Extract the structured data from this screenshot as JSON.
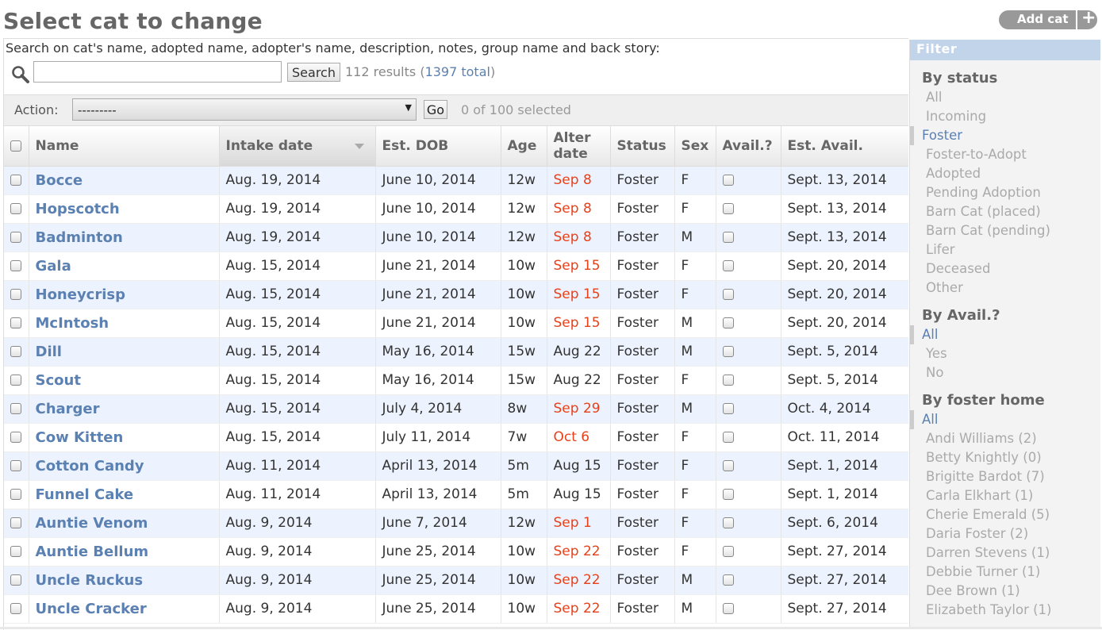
{
  "header": {
    "title": "Select cat to change",
    "add_label": "Add cat",
    "add_icon": "+"
  },
  "search": {
    "label": "Search on cat's name, adopted name, adopter's name, description, notes, group name and back story:",
    "value": "",
    "placeholder": "",
    "button_label": "Search",
    "results_prefix": "112 results (",
    "results_link": "1397 total",
    "results_suffix": ")"
  },
  "actions": {
    "label": "Action:",
    "selected_option": "---------",
    "go_label": "Go",
    "selected_count": "0 of 100 selected"
  },
  "table": {
    "columns": {
      "name": "Name",
      "intake": "Intake date",
      "dob": "Est. DOB",
      "age": "Age",
      "alter_line1": "Alter",
      "alter_line2": "date",
      "status": "Status",
      "sex": "Sex",
      "avail": "Avail.?",
      "est_avail": "Est. Avail."
    },
    "rows": [
      {
        "name": "Bocce",
        "intake": "Aug. 19, 2014",
        "dob": "June 10, 2014",
        "age": "12w",
        "alter": "Sep 8",
        "alter_overdue": true,
        "status": "Foster",
        "sex": "F",
        "est_avail": "Sept. 13, 2014"
      },
      {
        "name": "Hopscotch",
        "intake": "Aug. 19, 2014",
        "dob": "June 10, 2014",
        "age": "12w",
        "alter": "Sep 8",
        "alter_overdue": true,
        "status": "Foster",
        "sex": "F",
        "est_avail": "Sept. 13, 2014"
      },
      {
        "name": "Badminton",
        "intake": "Aug. 19, 2014",
        "dob": "June 10, 2014",
        "age": "12w",
        "alter": "Sep 8",
        "alter_overdue": true,
        "status": "Foster",
        "sex": "M",
        "est_avail": "Sept. 13, 2014"
      },
      {
        "name": "Gala",
        "intake": "Aug. 15, 2014",
        "dob": "June 21, 2014",
        "age": "10w",
        "alter": "Sep 15",
        "alter_overdue": true,
        "status": "Foster",
        "sex": "F",
        "est_avail": "Sept. 20, 2014"
      },
      {
        "name": "Honeycrisp",
        "intake": "Aug. 15, 2014",
        "dob": "June 21, 2014",
        "age": "10w",
        "alter": "Sep 15",
        "alter_overdue": true,
        "status": "Foster",
        "sex": "F",
        "est_avail": "Sept. 20, 2014"
      },
      {
        "name": "McIntosh",
        "intake": "Aug. 15, 2014",
        "dob": "June 21, 2014",
        "age": "10w",
        "alter": "Sep 15",
        "alter_overdue": true,
        "status": "Foster",
        "sex": "M",
        "est_avail": "Sept. 20, 2014"
      },
      {
        "name": "Dill",
        "intake": "Aug. 15, 2014",
        "dob": "May 16, 2014",
        "age": "15w",
        "alter": "Aug 22",
        "alter_overdue": false,
        "status": "Foster",
        "sex": "M",
        "est_avail": "Sept. 5, 2014"
      },
      {
        "name": "Scout",
        "intake": "Aug. 15, 2014",
        "dob": "May 16, 2014",
        "age": "15w",
        "alter": "Aug 22",
        "alter_overdue": false,
        "status": "Foster",
        "sex": "F",
        "est_avail": "Sept. 5, 2014"
      },
      {
        "name": "Charger",
        "intake": "Aug. 15, 2014",
        "dob": "July 4, 2014",
        "age": "8w",
        "alter": "Sep 29",
        "alter_overdue": true,
        "status": "Foster",
        "sex": "M",
        "est_avail": "Oct. 4, 2014"
      },
      {
        "name": "Cow Kitten",
        "intake": "Aug. 15, 2014",
        "dob": "July 11, 2014",
        "age": "7w",
        "alter": "Oct 6",
        "alter_overdue": true,
        "status": "Foster",
        "sex": "F",
        "est_avail": "Oct. 11, 2014"
      },
      {
        "name": "Cotton Candy",
        "intake": "Aug. 11, 2014",
        "dob": "April 13, 2014",
        "age": "5m",
        "alter": "Aug 15",
        "alter_overdue": false,
        "status": "Foster",
        "sex": "F",
        "est_avail": "Sept. 1, 2014"
      },
      {
        "name": "Funnel Cake",
        "intake": "Aug. 11, 2014",
        "dob": "April 13, 2014",
        "age": "5m",
        "alter": "Aug 15",
        "alter_overdue": false,
        "status": "Foster",
        "sex": "F",
        "est_avail": "Sept. 1, 2014"
      },
      {
        "name": "Auntie Venom",
        "intake": "Aug. 9, 2014",
        "dob": "June 7, 2014",
        "age": "12w",
        "alter": "Sep 1",
        "alter_overdue": true,
        "status": "Foster",
        "sex": "F",
        "est_avail": "Sept. 6, 2014"
      },
      {
        "name": "Auntie Bellum",
        "intake": "Aug. 9, 2014",
        "dob": "June 25, 2014",
        "age": "10w",
        "alter": "Sep 22",
        "alter_overdue": true,
        "status": "Foster",
        "sex": "F",
        "est_avail": "Sept. 27, 2014"
      },
      {
        "name": "Uncle Ruckus",
        "intake": "Aug. 9, 2014",
        "dob": "June 25, 2014",
        "age": "10w",
        "alter": "Sep 22",
        "alter_overdue": true,
        "status": "Foster",
        "sex": "M",
        "est_avail": "Sept. 27, 2014"
      },
      {
        "name": "Uncle Cracker",
        "intake": "Aug. 9, 2014",
        "dob": "June 25, 2014",
        "age": "10w",
        "alter": "Sep 22",
        "alter_overdue": true,
        "status": "Foster",
        "sex": "M",
        "est_avail": "Sept. 27, 2014"
      }
    ]
  },
  "filter": {
    "title": "Filter",
    "groups": [
      {
        "heading": "By status",
        "options": [
          {
            "label": "All",
            "selected": false
          },
          {
            "label": "Incoming",
            "selected": false
          },
          {
            "label": "Foster",
            "selected": true
          },
          {
            "label": "Foster-to-Adopt",
            "selected": false
          },
          {
            "label": "Adopted",
            "selected": false
          },
          {
            "label": "Pending Adoption",
            "selected": false
          },
          {
            "label": "Barn Cat (placed)",
            "selected": false
          },
          {
            "label": "Barn Cat (pending)",
            "selected": false
          },
          {
            "label": "Lifer",
            "selected": false
          },
          {
            "label": "Deceased",
            "selected": false
          },
          {
            "label": "Other",
            "selected": false
          }
        ]
      },
      {
        "heading": "By Avail.?",
        "options": [
          {
            "label": "All",
            "selected": true
          },
          {
            "label": "Yes",
            "selected": false
          },
          {
            "label": "No",
            "selected": false
          }
        ]
      },
      {
        "heading": "By foster home",
        "options": [
          {
            "label": "All",
            "selected": true
          },
          {
            "label": "Andi Williams (2)",
            "selected": false
          },
          {
            "label": "Betty Knightly (0)",
            "selected": false
          },
          {
            "label": "Brigitte Bardot (7)",
            "selected": false
          },
          {
            "label": "Carla Elkhart (1)",
            "selected": false
          },
          {
            "label": "Cherie Emerald (5)",
            "selected": false
          },
          {
            "label": "Daria Foster (2)",
            "selected": false
          },
          {
            "label": "Darren Stevens (1)",
            "selected": false
          },
          {
            "label": "Debbie Turner (1)",
            "selected": false
          },
          {
            "label": "Dee Brown (1)",
            "selected": false
          },
          {
            "label": "Elizabeth Taylor (1)",
            "selected": false
          }
        ]
      }
    ]
  },
  "colors": {
    "link": "#5b80b2",
    "overdue": "#e8411a",
    "row_alt": "#edf3fe",
    "filter_header": "#c2d4ea"
  }
}
